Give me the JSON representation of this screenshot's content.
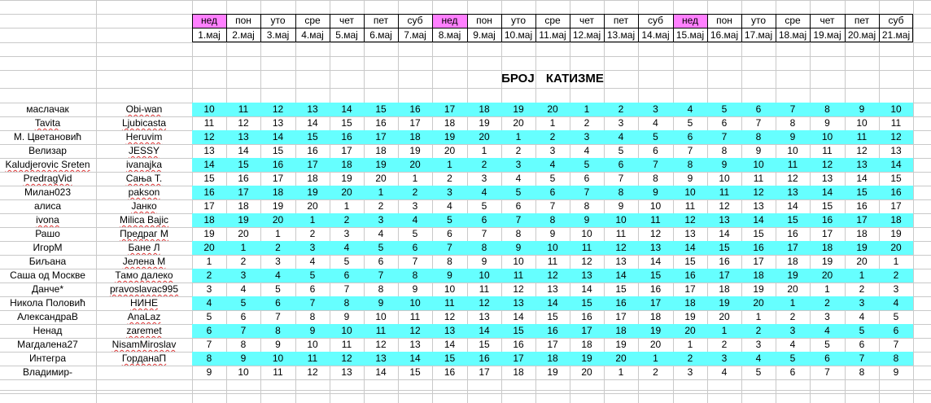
{
  "spreadsheet": {
    "title": "БРОЈ    КАТИЗМЕ",
    "days": [
      "нед",
      "пон",
      "уто",
      "сре",
      "чет",
      "пет",
      "суб",
      "нед",
      "пон",
      "уто",
      "сре",
      "чет",
      "пет",
      "суб",
      "нед",
      "пон",
      "уто",
      "сре",
      "чет",
      "пет",
      "суб"
    ],
    "dates": [
      "1.мај",
      "2.мај",
      "3.мај",
      "4.мај",
      "5.мај",
      "6.мај",
      "7.мај",
      "8.мај",
      "9.мај",
      "10.мај",
      "11.мај",
      "12.мај",
      "13.мај",
      "14.мај",
      "15.мај",
      "16.мај",
      "17.мај",
      "18.мај",
      "19.мај",
      "20.мај",
      "21.мај"
    ],
    "highlight_color_sunday": "#ff80ff",
    "highlight_color_row": "#66ffff",
    "rows": [
      {
        "name": "маслачак",
        "nick": "Obi-wan",
        "values": [
          "10",
          "11",
          "12",
          "13",
          "14",
          "15",
          "16",
          "17",
          "18",
          "19",
          "20",
          "1",
          "2",
          "3",
          "4",
          "5",
          "6",
          "7",
          "8",
          "9",
          "10"
        ]
      },
      {
        "name": "Tavita",
        "nick": "Ljubicasta",
        "values": [
          "11",
          "12",
          "13",
          "14",
          "15",
          "16",
          "17",
          "18",
          "19",
          "20",
          "1",
          "2",
          "3",
          "4",
          "5",
          "6",
          "7",
          "8",
          "9",
          "10",
          "11"
        ]
      },
      {
        "name": "М. Цветановић",
        "nick": "Heruvim",
        "values": [
          "12",
          "13",
          "14",
          "15",
          "16",
          "17",
          "18",
          "19",
          "20",
          "1",
          "2",
          "3",
          "4",
          "5",
          "6",
          "7",
          "8",
          "9",
          "10",
          "11",
          "12"
        ]
      },
      {
        "name": "Велизар",
        "nick": "JESSY",
        "values": [
          "13",
          "14",
          "15",
          "16",
          "17",
          "18",
          "19",
          "20",
          "1",
          "2",
          "3",
          "4",
          "5",
          "6",
          "7",
          "8",
          "9",
          "10",
          "11",
          "12",
          "13"
        ]
      },
      {
        "name": "Kaludjerovic Sreten",
        "nick": "ivanajka",
        "values": [
          "14",
          "15",
          "16",
          "17",
          "18",
          "19",
          "20",
          "1",
          "2",
          "3",
          "4",
          "5",
          "6",
          "7",
          "8",
          "9",
          "10",
          "11",
          "12",
          "13",
          "14"
        ]
      },
      {
        "name": "PredragVid",
        "nick": "Сања Т.",
        "values": [
          "15",
          "16",
          "17",
          "18",
          "19",
          "20",
          "1",
          "2",
          "3",
          "4",
          "5",
          "6",
          "7",
          "8",
          "9",
          "10",
          "11",
          "12",
          "13",
          "14",
          "15"
        ]
      },
      {
        "name": "Милан023",
        "nick": "pakson",
        "values": [
          "16",
          "17",
          "18",
          "19",
          "20",
          "1",
          "2",
          "3",
          "4",
          "5",
          "6",
          "7",
          "8",
          "9",
          "10",
          "11",
          "12",
          "13",
          "14",
          "15",
          "16"
        ]
      },
      {
        "name": "алиса",
        "nick": "Јанко",
        "values": [
          "17",
          "18",
          "19",
          "20",
          "1",
          "2",
          "3",
          "4",
          "5",
          "6",
          "7",
          "8",
          "9",
          "10",
          "11",
          "12",
          "13",
          "14",
          "15",
          "16",
          "17"
        ]
      },
      {
        "name": "ivona",
        "nick": "Milica Bajic",
        "values": [
          "18",
          "19",
          "20",
          "1",
          "2",
          "3",
          "4",
          "5",
          "6",
          "7",
          "8",
          "9",
          "10",
          "11",
          "12",
          "13",
          "14",
          "15",
          "16",
          "17",
          "18"
        ]
      },
      {
        "name": "Рашо",
        "nick": "Предраг М",
        "values": [
          "19",
          "20",
          "1",
          "2",
          "3",
          "4",
          "5",
          "6",
          "7",
          "8",
          "9",
          "10",
          "11",
          "12",
          "13",
          "14",
          "15",
          "16",
          "17",
          "18",
          "19"
        ]
      },
      {
        "name": "ИгорМ",
        "nick": "Бане Л",
        "values": [
          "20",
          "1",
          "2",
          "3",
          "4",
          "5",
          "6",
          "7",
          "8",
          "9",
          "10",
          "11",
          "12",
          "13",
          "14",
          "15",
          "16",
          "17",
          "18",
          "19",
          "20"
        ]
      },
      {
        "name": "Биљана",
        "nick": "Јелена М",
        "values": [
          "1",
          "2",
          "3",
          "4",
          "5",
          "6",
          "7",
          "8",
          "9",
          "10",
          "11",
          "12",
          "13",
          "14",
          "15",
          "16",
          "17",
          "18",
          "19",
          "20",
          "1"
        ]
      },
      {
        "name": "Саша од Москве",
        "nick": "Тамо далеко",
        "values": [
          "2",
          "3",
          "4",
          "5",
          "6",
          "7",
          "8",
          "9",
          "10",
          "11",
          "12",
          "13",
          "14",
          "15",
          "16",
          "17",
          "18",
          "19",
          "20",
          "1",
          "2"
        ]
      },
      {
        "name": "Данче*",
        "nick": "pravoslavac995",
        "values": [
          "3",
          "4",
          "5",
          "6",
          "7",
          "8",
          "9",
          "10",
          "11",
          "12",
          "13",
          "14",
          "15",
          "16",
          "17",
          "18",
          "19",
          "20",
          "1",
          "2",
          "3"
        ]
      },
      {
        "name": "Никола Половић",
        "nick": "НИНЕ",
        "values": [
          "4",
          "5",
          "6",
          "7",
          "8",
          "9",
          "10",
          "11",
          "12",
          "13",
          "14",
          "15",
          "16",
          "17",
          "18",
          "19",
          "20",
          "1",
          "2",
          "3",
          "4"
        ]
      },
      {
        "name": "АлександраВ",
        "nick": "AnaLaz",
        "values": [
          "5",
          "6",
          "7",
          "8",
          "9",
          "10",
          "11",
          "12",
          "13",
          "14",
          "15",
          "16",
          "17",
          "18",
          "19",
          "20",
          "1",
          "2",
          "3",
          "4",
          "5"
        ]
      },
      {
        "name": "Ненад",
        "nick": "zaremet",
        "values": [
          "6",
          "7",
          "8",
          "9",
          "10",
          "11",
          "12",
          "13",
          "14",
          "15",
          "16",
          "17",
          "18",
          "19",
          "20",
          "1",
          "2",
          "3",
          "4",
          "5",
          "6"
        ]
      },
      {
        "name": "Магдалена27",
        "nick": "NisamMiroslav",
        "values": [
          "7",
          "8",
          "9",
          "10",
          "11",
          "12",
          "13",
          "14",
          "15",
          "16",
          "17",
          "18",
          "19",
          "20",
          "1",
          "2",
          "3",
          "4",
          "5",
          "6",
          "7"
        ]
      },
      {
        "name": "Интегра",
        "nick": "ГорданаП",
        "values": [
          "8",
          "9",
          "10",
          "11",
          "12",
          "13",
          "14",
          "15",
          "16",
          "17",
          "18",
          "19",
          "20",
          "1",
          "2",
          "3",
          "4",
          "5",
          "6",
          "7",
          "8"
        ]
      },
      {
        "name": "Владимир-",
        "nick": "",
        "values": [
          "9",
          "10",
          "11",
          "12",
          "13",
          "14",
          "15",
          "16",
          "17",
          "18",
          "19",
          "20",
          "1",
          "2",
          "3",
          "4",
          "5",
          "6",
          "7",
          "8",
          "9"
        ]
      }
    ]
  }
}
